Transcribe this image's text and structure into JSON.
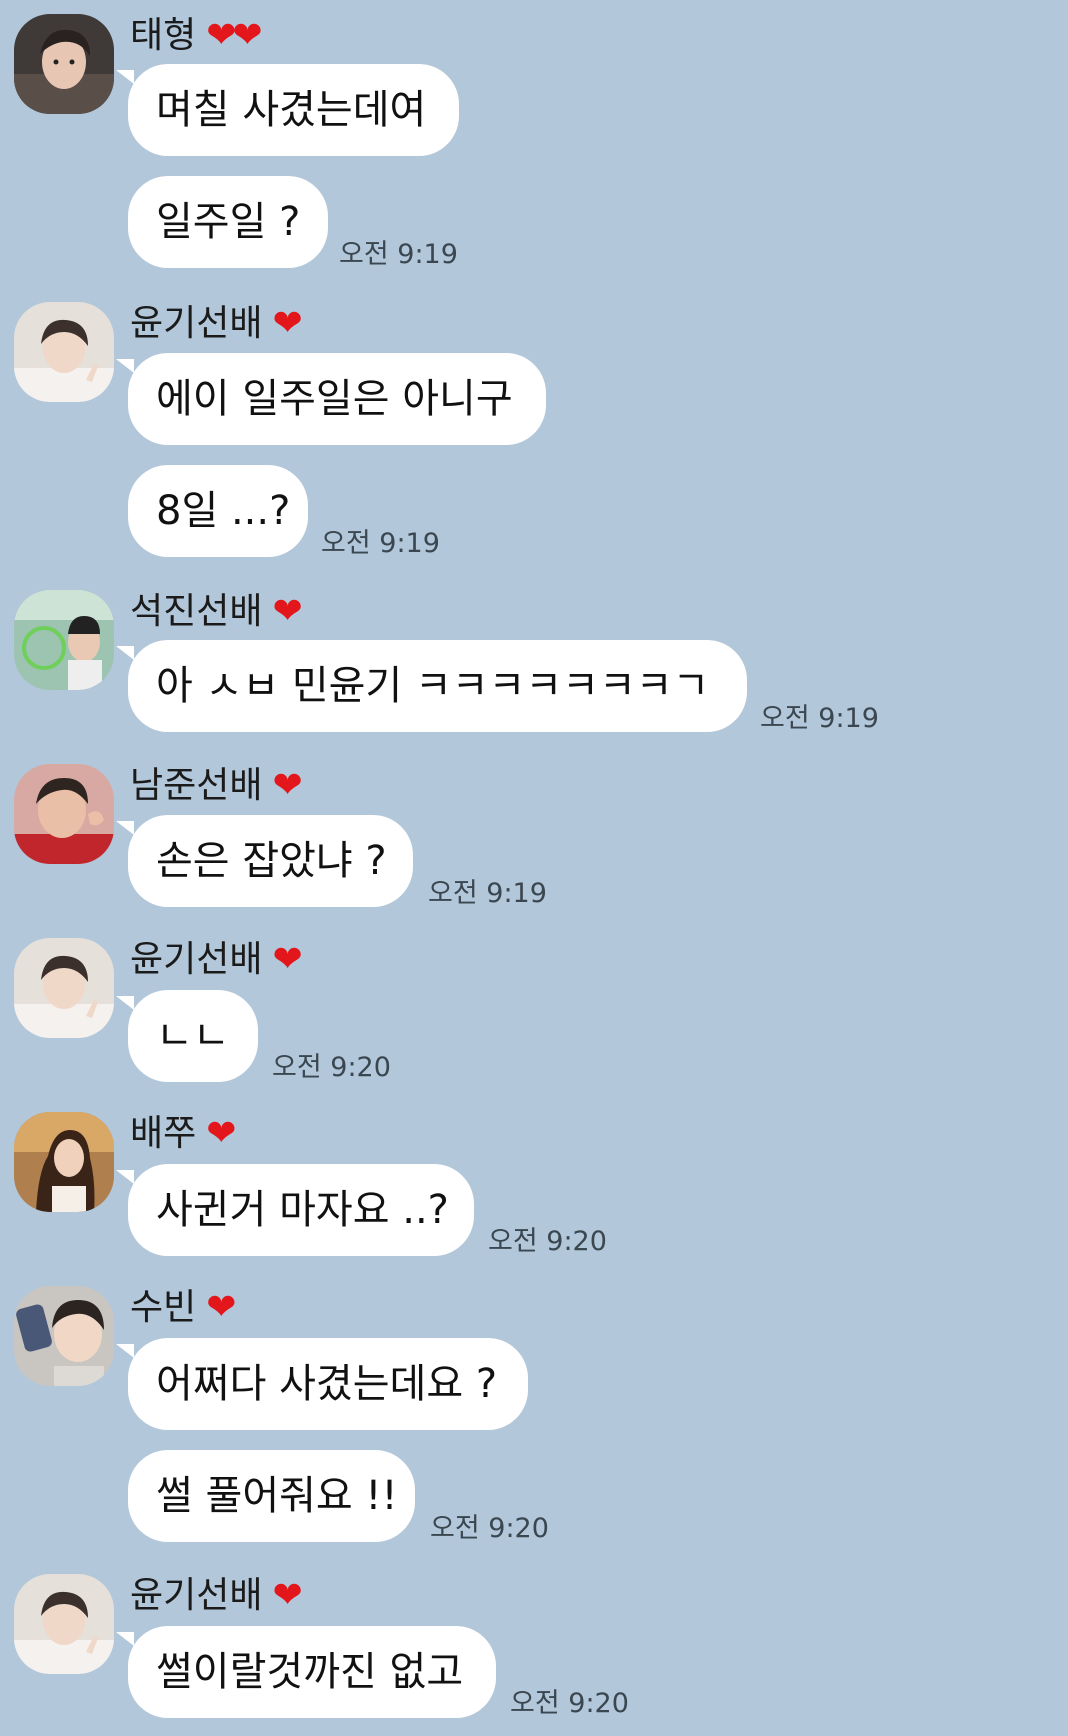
{
  "groups": [
    {
      "sender": "태형",
      "hearts": "❤❤",
      "messages": [
        {
          "text": "며칠 사겼는데여"
        },
        {
          "text": "일주일 ?",
          "time": "오전 9:19"
        }
      ],
      "avatar_color": "#6b5d56"
    },
    {
      "sender": "윤기선배",
      "hearts": "❤",
      "messages": [
        {
          "text": "에이 일주일은 아니구"
        },
        {
          "text": "8일 ...?",
          "time": "오전 9:19"
        }
      ],
      "avatar_color": "#d9cfc6"
    },
    {
      "sender": "석진선배",
      "hearts": "❤",
      "messages": [
        {
          "text": "아 ㅅㅂ 민윤기 ㅋㅋㅋㅋㅋㅋㅋㄱ",
          "time": "오전 9:19"
        }
      ],
      "avatar_color": "#8fb9a8"
    },
    {
      "sender": "남준선배",
      "hearts": "❤",
      "messages": [
        {
          "text": "손은 잡았냐 ?",
          "time": "오전 9:19"
        }
      ],
      "avatar_color": "#c98b86"
    },
    {
      "sender": "윤기선배",
      "hearts": "❤",
      "messages": [
        {
          "text": "ㄴㄴ",
          "time": "오전 9:20"
        }
      ],
      "avatar_color": "#d9cfc6"
    },
    {
      "sender": "배쭈",
      "hearts": "❤",
      "messages": [
        {
          "text": "사귄거 마자요 ..?",
          "time": "오전 9:20"
        }
      ],
      "avatar_color": "#b88f60"
    },
    {
      "sender": "수빈",
      "hearts": "❤",
      "messages": [
        {
          "text": "어쩌다 사겼는데요 ?"
        },
        {
          "text": "썰 풀어줘요 !!",
          "time": "오전 9:20"
        }
      ],
      "avatar_color": "#9a9fa6"
    },
    {
      "sender": "윤기선배",
      "hearts": "❤",
      "messages": [
        {
          "text": "썰이랄것까진 없고",
          "time": "오전 9:20"
        }
      ],
      "avatar_color": "#d9cfc6"
    }
  ],
  "colors": {
    "background": "#b2c7da",
    "bubble": "#ffffff",
    "heart": "#e3161b",
    "time": "#3b4750"
  },
  "icons": {
    "heart": "heart-icon",
    "avatar": "profile-photo"
  }
}
